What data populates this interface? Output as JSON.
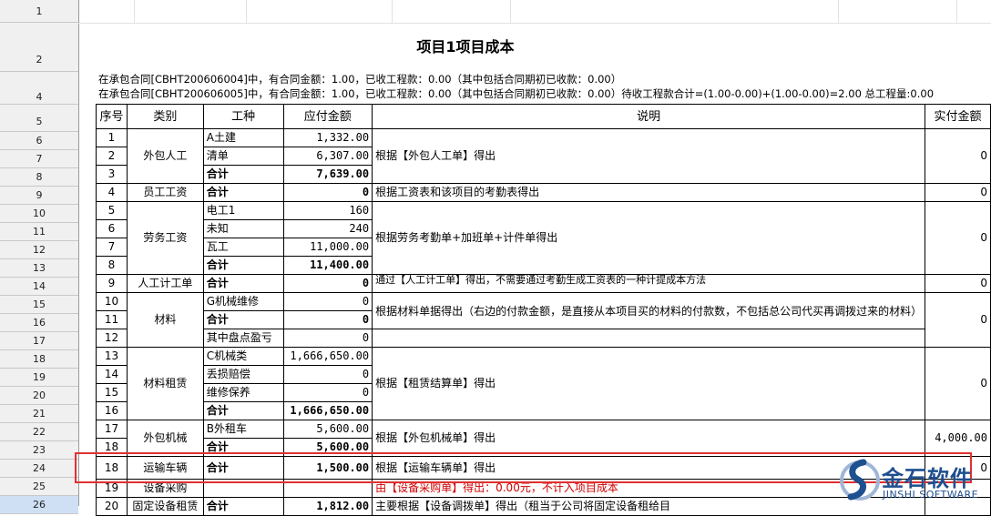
{
  "row_numbers": [
    "1",
    "2",
    "4",
    "5",
    "6",
    "7",
    "8",
    "9",
    "10",
    "11",
    "12",
    "13",
    "14",
    "15",
    "16",
    "17",
    "18",
    "19",
    "20",
    "21",
    "22",
    "23",
    "24",
    "25",
    "26"
  ],
  "title": "项目1项目成本",
  "info_lines": [
    "在承包合同[CBHT200606004]中，有合同金额：1.00，已收工程款：0.00（其中包括合同期初已收款：0.00）",
    "在承包合同[CBHT200606005]中，有合同金额：1.00，已收工程款：0.00（其中包括合同期初已收款：0.00）待收工程款合计=(1.00-0.00)+(1.00-0.00)=2.00   总工程量:0.00"
  ],
  "table": {
    "headers": [
      "序号",
      "类别",
      "工种",
      "应付金额",
      "说明",
      "实付金额"
    ],
    "rows": [
      {
        "no": "1",
        "type": "外包人工",
        "work": "A土建",
        "amount": "1,332.00",
        "desc": "根据【外包人工单】得出",
        "paid": "0"
      },
      {
        "no": "2",
        "work": "清单",
        "amount": "6,307.00"
      },
      {
        "no": "3",
        "work": "合计",
        "amount": "7,639.00"
      },
      {
        "no": "4",
        "type": "员工工资",
        "work": "合计",
        "amount": "0",
        "desc": "根据工资表和该项目的考勤表得出",
        "paid": "0"
      },
      {
        "no": "5",
        "type": "劳务工资",
        "work": "电工1",
        "amount": "160",
        "desc": "根据劳务考勤单+加班单+计件单得出",
        "paid": "0"
      },
      {
        "no": "6",
        "work": "未知",
        "amount": "240"
      },
      {
        "no": "7",
        "work": "瓦工",
        "amount": "11,000.00"
      },
      {
        "no": "8",
        "work": "合计",
        "amount": "11,400.00"
      },
      {
        "no": "9",
        "type": "人工计工单",
        "work": "合计",
        "amount": "0",
        "desc": "通过【人工计工单】得出，不需要通过考勤生成工资表的一种计提成本方法",
        "paid": "0"
      },
      {
        "no": "10",
        "type": "材料",
        "work": "G机械维修",
        "amount": "0",
        "desc": "根据材料单据得出（右边的付款金额，是直接从本项目买的材料的付款数，不包括总公司代买再调拨过来的材料）",
        "paid": "0"
      },
      {
        "no": "11",
        "work": "合计",
        "amount": "0"
      },
      {
        "no": "12",
        "work": "其中盘点盈亏",
        "amount": "0"
      },
      {
        "no": "13",
        "type": "材料租赁",
        "work": "C机械类",
        "amount": "1,666,650.00",
        "desc": "根据【租赁结算单】得出",
        "paid": "0"
      },
      {
        "no": "14",
        "work": "丢损赔偿",
        "amount": "0"
      },
      {
        "no": "15",
        "work": "维修保养",
        "amount": "0"
      },
      {
        "no": "16",
        "work": "合计",
        "amount": "1,666,650.00"
      },
      {
        "no": "17",
        "type": "外包机械",
        "work": "B外租车",
        "amount": "5,600.00",
        "desc": "根据【外包机械单】得出",
        "paid": "4,000.00"
      },
      {
        "no": "18",
        "work": "合计",
        "amount": "5,600.00"
      },
      {
        "no": "18",
        "type": "运输车辆",
        "work": "合计",
        "amount": "1,500.00",
        "desc": "根据【运输车辆单】得出",
        "paid": "0"
      },
      {
        "no": "19",
        "type": "设备采购",
        "work": "",
        "amount": "",
        "desc": "由【设备采购单】得出：0.00元，不计入项目成本",
        "paid": ""
      },
      {
        "no": "20",
        "type": "固定设备租赁",
        "work": "合计",
        "amount": "1,812.00",
        "desc": "主要根据【设备调拨单】得出（租当于公司将固定设备租给目",
        "paid": ""
      }
    ]
  },
  "logo": {
    "cn": "金石软件",
    "en": "JINSHI SOFTWARE"
  },
  "colors": {
    "highlight_box": "#e03030",
    "red_text": "#d00000",
    "logo": "#1e4f8f",
    "header_bg": "#f0f0f0"
  }
}
